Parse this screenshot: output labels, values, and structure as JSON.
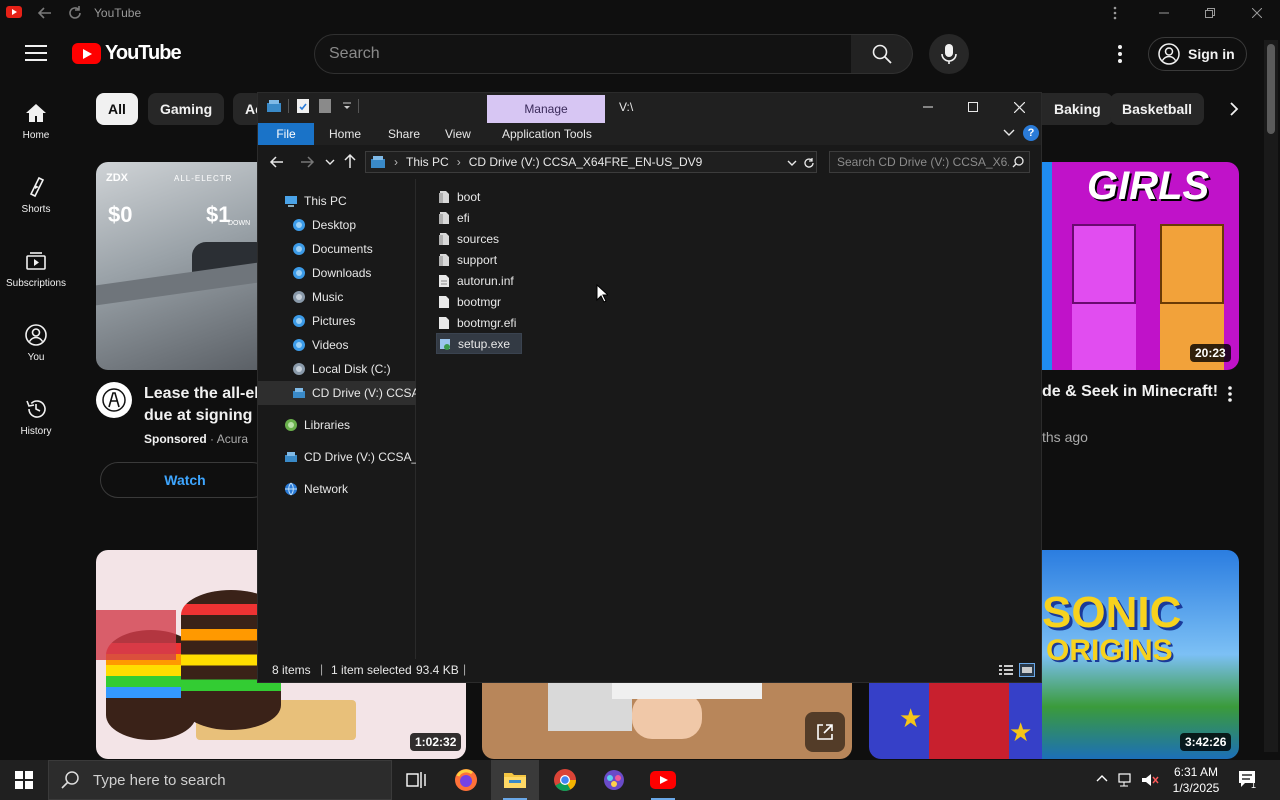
{
  "browser": {
    "title": "YouTube"
  },
  "youtube": {
    "logo_text": "YouTube",
    "search_placeholder": "Search",
    "signin_label": "Sign in",
    "sidebar": [
      {
        "label": "Home",
        "icon": "home-icon"
      },
      {
        "label": "Shorts",
        "icon": "shorts-icon"
      },
      {
        "label": "Subscriptions",
        "icon": "subscriptions-icon"
      },
      {
        "label": "You",
        "icon": "you-icon"
      },
      {
        "label": "History",
        "icon": "history-icon"
      }
    ],
    "chips": {
      "all": "All",
      "gaming": "Gaming",
      "partial": "Ac",
      "baking": "Baking",
      "basketball": "Basketball"
    },
    "ad": {
      "title_line1": "Lease the all-ele",
      "title_line2": "due at signing a",
      "sponsored": "Sponsored",
      "advertiser": "Acura",
      "watch_label": "Watch",
      "thumb_brand": "ZDX",
      "thumb_tagline": "ALL-ELECTR",
      "thumb_price1": "$0",
      "thumb_price2": "$1",
      "thumb_down": "DOWN"
    },
    "video_top_right": {
      "title": "de & Seek in Minecraft!",
      "meta": "ths ago",
      "thumb_text": "GIRLS",
      "duration": "20:23"
    },
    "video_bottom_left": {
      "duration": "1:02:32"
    },
    "video_bottom_right": {
      "duration": "3:42:26",
      "thumb_text1": "SONIC",
      "thumb_text2": "ORIGINS"
    }
  },
  "explorer": {
    "manage_tab": "Manage",
    "path_title": "V:\\",
    "ribbon_tabs": [
      "File",
      "Home",
      "Share",
      "View",
      "Application Tools"
    ],
    "address": {
      "segment1": "This PC",
      "segment2": "CD Drive (V:) CCSA_X64FRE_EN-US_DV9"
    },
    "search_placeholder": "Search CD Drive (V:) CCSA_X6...",
    "nav": [
      {
        "label": "This PC",
        "level": 0
      },
      {
        "label": "Desktop",
        "level": 1
      },
      {
        "label": "Documents",
        "level": 1
      },
      {
        "label": "Downloads",
        "level": 1
      },
      {
        "label": "Music",
        "level": 1
      },
      {
        "label": "Pictures",
        "level": 1
      },
      {
        "label": "Videos",
        "level": 1
      },
      {
        "label": "Local Disk (C:)",
        "level": 1
      },
      {
        "label": "CD Drive (V:) CCSA_",
        "level": 1
      },
      {
        "label": "Libraries",
        "level": 0
      },
      {
        "label": "CD Drive (V:) CCSA_X",
        "level": 0
      },
      {
        "label": "Network",
        "level": 0
      }
    ],
    "files": [
      {
        "name": "boot",
        "type": "folder"
      },
      {
        "name": "efi",
        "type": "folder"
      },
      {
        "name": "sources",
        "type": "folder"
      },
      {
        "name": "support",
        "type": "folder"
      },
      {
        "name": "autorun.inf",
        "type": "file"
      },
      {
        "name": "bootmgr",
        "type": "file"
      },
      {
        "name": "bootmgr.efi",
        "type": "file"
      },
      {
        "name": "setup.exe",
        "type": "exe"
      }
    ],
    "status": {
      "items": "8 items",
      "selected": "1 item selected",
      "size": "93.4 KB"
    }
  },
  "taskbar": {
    "search_placeholder": "Type here to search",
    "time": "6:31 AM",
    "date": "1/3/2025",
    "notification_count": "1"
  }
}
